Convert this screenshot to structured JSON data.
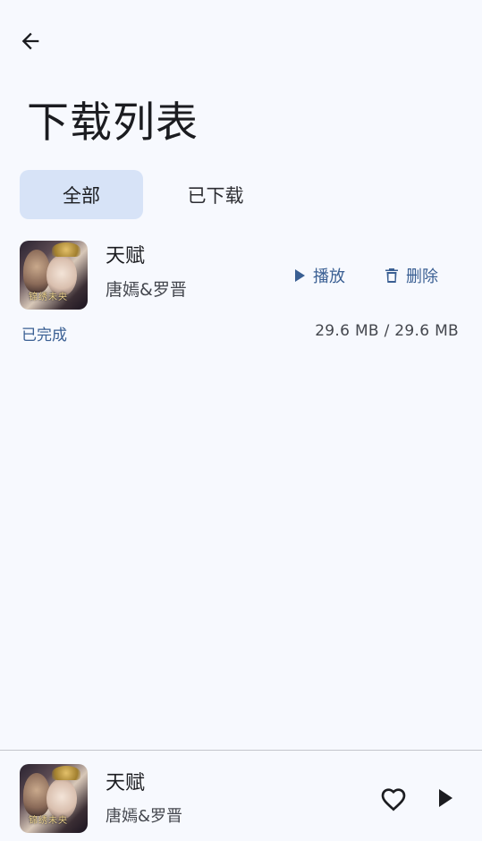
{
  "header": {
    "back_icon": "arrow-left-icon",
    "title": "下载列表"
  },
  "tabs": [
    {
      "label": "全部",
      "active": true
    },
    {
      "label": "已下载",
      "active": false
    }
  ],
  "downloads": [
    {
      "title": "天赋",
      "artist": "唐嫣&罗晋",
      "cover_text": "锦绣未央",
      "play_label": "播放",
      "play_icon": "play-icon",
      "delete_label": "删除",
      "delete_icon": "trash-icon",
      "status": "已完成",
      "size": "29.6 MB / 29.6 MB"
    }
  ],
  "mini_player": {
    "title": "天赋",
    "artist": "唐嫣&罗晋",
    "cover_text": "锦绣未央",
    "favorite_icon": "heart-outline-icon",
    "play_icon": "play-icon"
  },
  "colors": {
    "background": "#f7f9fe",
    "accent": "#3a5f93",
    "active_tab": "#d7e3f7",
    "text_primary": "#1b1c20",
    "text_secondary": "#44474e"
  }
}
